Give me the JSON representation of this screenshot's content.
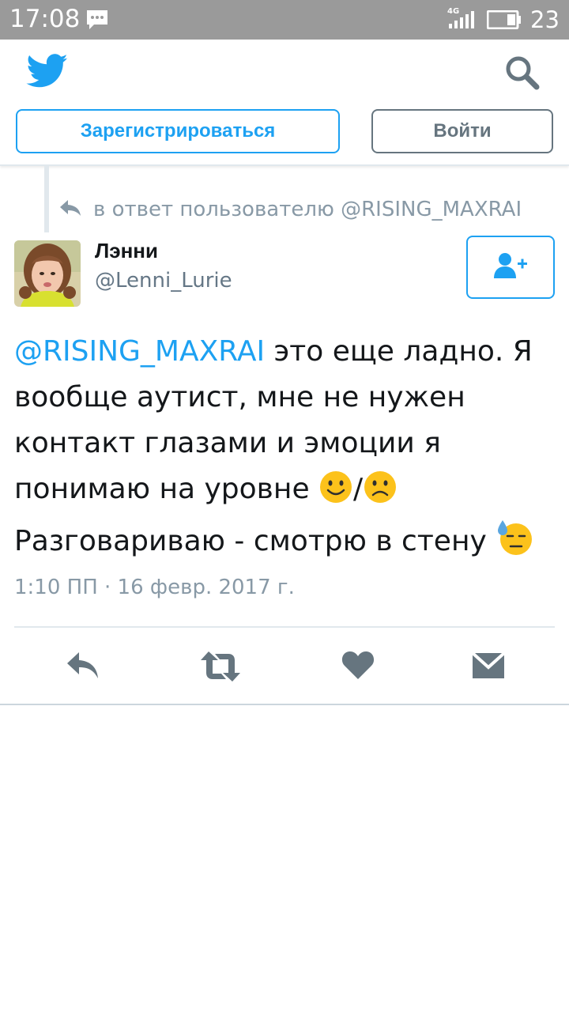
{
  "status_bar": {
    "time": "17:08",
    "network": "4G",
    "battery": "23",
    "icons": [
      "message-icon",
      "signal-icon",
      "battery-icon"
    ]
  },
  "header": {
    "logo_icon": "twitter-bird-icon",
    "search_icon": "search-icon",
    "signup_label": "Зарегистрироваться",
    "login_label": "Войти"
  },
  "tweet": {
    "reply_context": "в ответ пользователю @RISING_MAXRAI",
    "author_name": "Лэнни",
    "author_handle": "@Lenni_Lurie",
    "mention": "@RISING_MAXRAI",
    "text_part1": " это еще ладно. Я вообще аутист, мне не нужен контакт глазами и эмоции я понимаю на уровне ",
    "slash": "/",
    "text_part2": "Разговариваю - смотрю в стену ",
    "timestamp": "1:10 ПП · 16 февр. 2017 г.",
    "emoji": [
      "slightly-smiling-face",
      "slightly-frowning-face",
      "downcast-face-with-sweat"
    ]
  },
  "actions": [
    "reply-icon",
    "retweet-icon",
    "like-icon",
    "message-icon"
  ],
  "colors": {
    "accent": "#1da1f2",
    "secondary": "#66757f",
    "muted": "#8899a6",
    "status_bar": "#9a9a9a"
  }
}
